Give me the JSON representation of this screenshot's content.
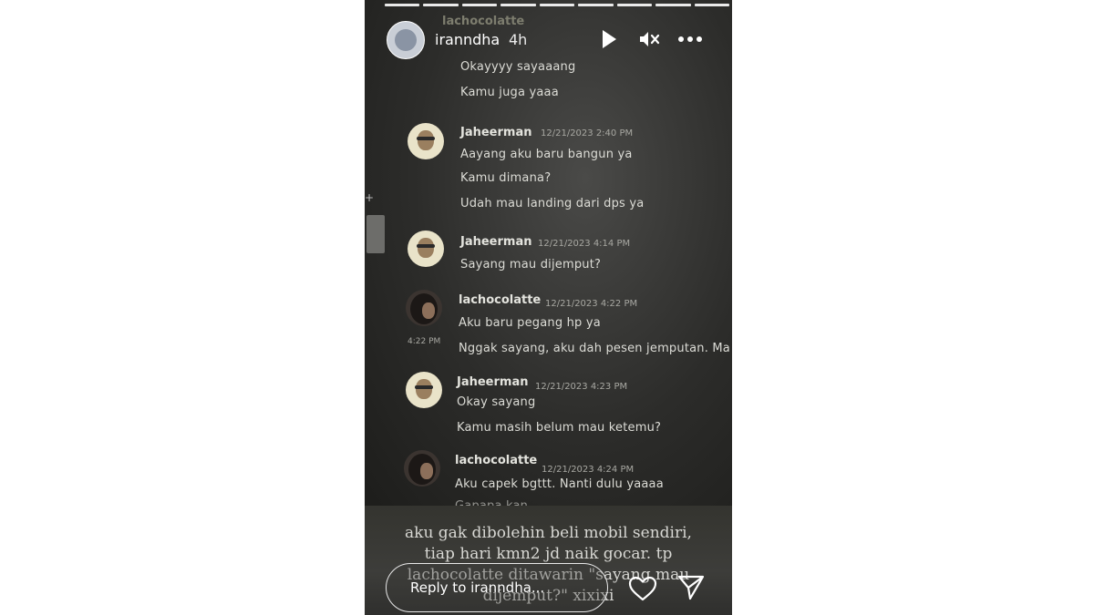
{
  "story": {
    "username": "iranndha",
    "time_ago": "4h",
    "ghost_header": "lachocolatte",
    "progress_segments": 9
  },
  "chat": {
    "messages_top": [
      "Okayyyy sayaaang",
      "Kamu juga yaaa"
    ],
    "groups": [
      {
        "author": "Jaheerman",
        "timestamp": "12/21/2023 2:40 PM",
        "avatar": "jaheerman",
        "lines": [
          "Aayang aku baru bangun ya",
          "Kamu dimana?",
          "Udah mau landing dari dps ya"
        ]
      },
      {
        "author": "Jaheerman",
        "timestamp": "12/21/2023 4:14 PM",
        "avatar": "jaheerman",
        "lines": [
          "Sayang mau dijemput?"
        ]
      },
      {
        "author": "lachocolatte",
        "timestamp": "12/21/2023 4:22 PM",
        "avatar": "lachocolatte",
        "lines": [
          "Aku baru pegang hp ya",
          "Nggak sayang, aku dah pesen jemputan. Ma"
        ],
        "side_time": "4:22 PM"
      },
      {
        "author": "Jaheerman",
        "timestamp": "12/21/2023 4:23 PM",
        "avatar": "jaheerman",
        "lines": [
          "Okay sayang",
          "Kamu masih belum mau ketemu?"
        ]
      },
      {
        "author": "lachocolatte",
        "timestamp": "12/21/2023 4:24 PM",
        "avatar": "lachocolatte",
        "lines": [
          "Aku capek bgttt. Nanti dulu yaaaa",
          "Gapapa kan"
        ]
      }
    ]
  },
  "caption": {
    "lines": [
      "aku gak dibolehin beli mobil sendiri,",
      "tiap hari kmn2 jd naik gocar. tp",
      "lachocolatte ditawarin \"sayang mau",
      "dijemput?\" xixixi"
    ]
  },
  "reply": {
    "placeholder": "Reply to iranndha..."
  },
  "icons": {
    "play": "play-icon",
    "mute": "mute-icon",
    "more": "more-icon",
    "heart": "heart-icon",
    "send": "send-icon"
  }
}
